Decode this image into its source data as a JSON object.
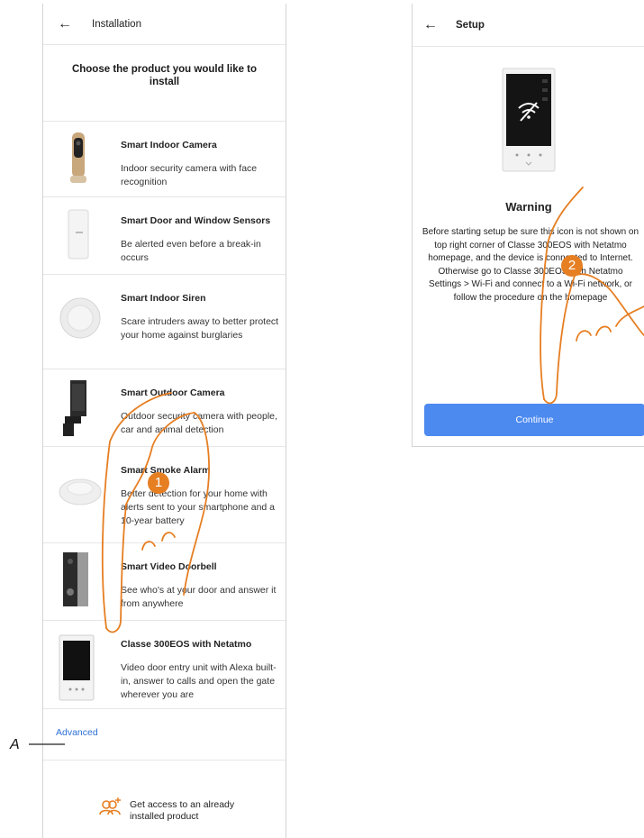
{
  "left": {
    "header_title": "Installation",
    "heading": "Choose the product you would like to install",
    "products": [
      {
        "name": "Smart Indoor Camera",
        "desc": "Indoor security camera with face recognition"
      },
      {
        "name": "Smart Door and Window Sensors",
        "desc": "Be alerted even before a break-in occurs"
      },
      {
        "name": "Smart Indoor Siren",
        "desc": "Scare intruders away to better protect your home against burglaries"
      },
      {
        "name": "Smart Outdoor Camera",
        "desc": "Outdoor security camera with people, car and animal detection"
      },
      {
        "name": "Smart Smoke Alarm",
        "desc": "Better detection for your home with alerts sent to your smartphone and a 10-year battery"
      },
      {
        "name": "Smart Video Doorbell",
        "desc": "See who's at your door and answer it from anywhere"
      },
      {
        "name": "Classe 300EOS with Netatmo",
        "desc": "Video door entry unit with Alexa built-in, answer to calls and open the gate wherever you are"
      }
    ],
    "advanced_label": "Advanced",
    "access_label": "Get access to an already installed product"
  },
  "right": {
    "header_title": "Setup",
    "warning_title": "Warning",
    "warning_text": "Before starting setup be sure this icon is not shown on top right corner of Classe 300EOS with Netatmo homepage, and the device is connected to Internet. Otherwise go to Classe 300EOS with Netatmo Settings > Wi-Fi and connect to a Wi-Fi network, or follow the procedure on the homepage",
    "continue_label": "Continue"
  },
  "annotations": {
    "marker_1": "1",
    "marker_2": "2",
    "label_a": "A"
  },
  "colors": {
    "accent_blue": "#4d8af0",
    "link_blue": "#2c6fd6",
    "marker_orange": "#e67e22"
  },
  "icons": [
    "back-arrow-icon",
    "add-users-icon",
    "no-wifi-icon",
    "pointing-hand-icon"
  ]
}
